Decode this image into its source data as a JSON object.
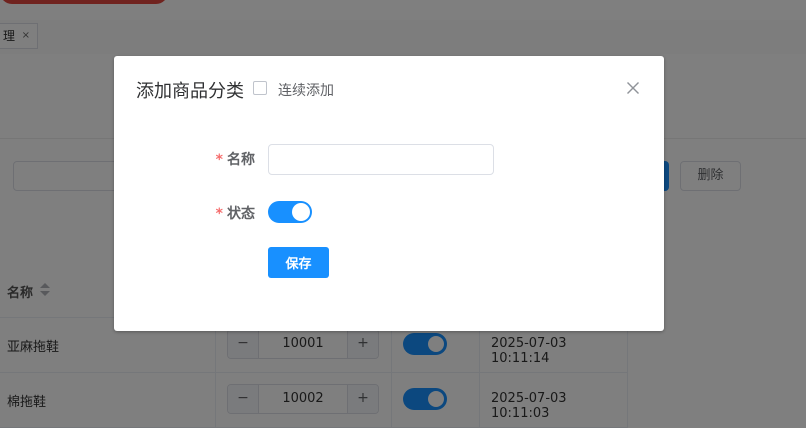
{
  "tabs": [
    {
      "label": "理",
      "close": "×"
    }
  ],
  "toolbar": {
    "delete_label": "删除"
  },
  "table": {
    "headers": {
      "name": "名称"
    },
    "rows": [
      {
        "name": "亚麻拖鞋",
        "sort": "10001",
        "date": "2025-07-03 10:11:14"
      },
      {
        "name": "棉拖鞋",
        "sort": "10002",
        "date": "2025-07-03 10:11:03"
      }
    ]
  },
  "dialog": {
    "title": "添加商品分类",
    "continuous_label": "连续添加",
    "continuous_checked": false,
    "name_label": "名称",
    "name_value": "",
    "status_label": "状态",
    "status_on": true,
    "required_mark": "*",
    "save_label": "保存"
  },
  "stepper": {
    "minus": "−",
    "plus": "+"
  },
  "colors": {
    "primary": "#1890ff",
    "required": "#f56c6c",
    "header_accent": "#e0463f"
  },
  "icons": {
    "close": "close-icon",
    "sort": "sort-icon"
  }
}
